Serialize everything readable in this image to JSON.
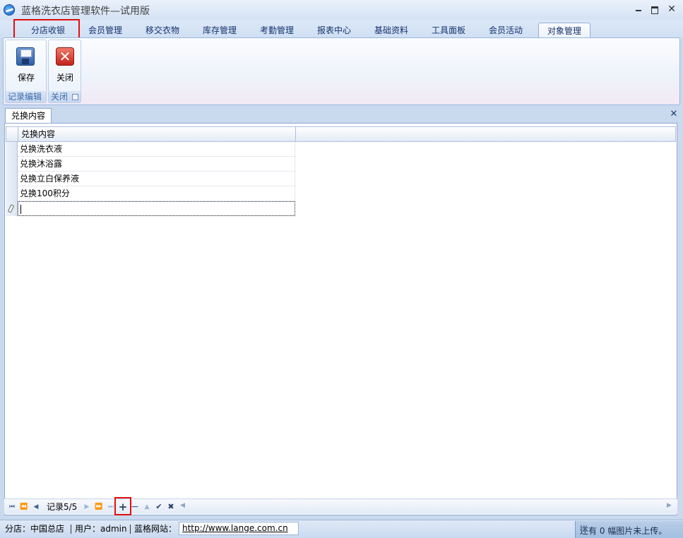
{
  "window": {
    "title": "蓝格洗衣店管理软件—试用版"
  },
  "ribbon_tabs": [
    {
      "label": "分店收银"
    },
    {
      "label": "会员管理"
    },
    {
      "label": "移交衣物"
    },
    {
      "label": "库存管理"
    },
    {
      "label": "考勤管理"
    },
    {
      "label": "报表中心"
    },
    {
      "label": "基础资料"
    },
    {
      "label": "工具面板"
    },
    {
      "label": "会员活动"
    },
    {
      "label": "对象管理"
    }
  ],
  "ribbon": {
    "groups": [
      {
        "label": "记录编辑",
        "buttons": [
          {
            "label": "保存",
            "icon": "save-icon"
          }
        ]
      },
      {
        "label": "关闭",
        "buttons": [
          {
            "label": "关闭",
            "icon": "close-icon"
          }
        ]
      }
    ]
  },
  "document": {
    "tab_label": "兑换内容"
  },
  "grid": {
    "column_header": "兑换内容",
    "rows": [
      "兑换洗衣液",
      "兑换沐浴露",
      "兑换立白保养液",
      "兑换100积分"
    ]
  },
  "navigator": {
    "record_text": "记录5/5"
  },
  "statusbar": {
    "branch": "分店：中国总店",
    "user": "用户：admin",
    "site_label": "蓝格网站：",
    "url": "http://www.lange.com.cn",
    "upload_notice": "还有 0 幅图片未上传。"
  },
  "colors": {
    "highlight": "#e01010",
    "accent": "#15316b"
  }
}
